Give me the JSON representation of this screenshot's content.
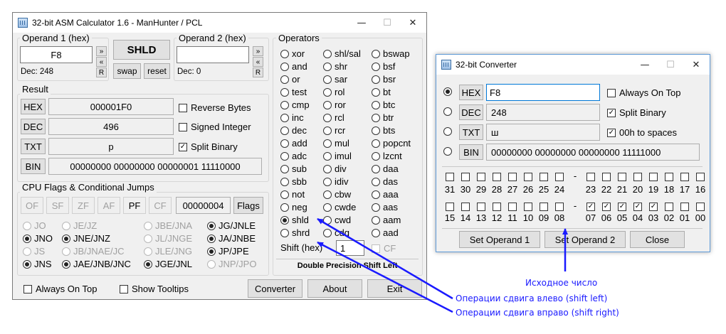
{
  "main": {
    "title": "32-bit ASM Calculator 1.6 - ManHunter / PCL",
    "operand1": {
      "label": "Operand 1 (hex)",
      "value": "F8",
      "dec_label": "Dec: 248"
    },
    "operand2": {
      "label": "Operand 2 (hex)",
      "value": "",
      "dec_label": "Dec: 0"
    },
    "mini": {
      "up": "»",
      "down": "«",
      "reset": "R"
    },
    "op_button": "SHLD",
    "swap": "swap",
    "reset": "reset",
    "result": {
      "label": "Result",
      "hex_btn": "HEX",
      "hex": "000001F0",
      "dec_btn": "DEC",
      "dec": "496",
      "txt_btn": "TXT",
      "txt": "\u0001p",
      "bin_btn": "BIN",
      "bin": "00000000 00000000 00000001 11110000",
      "reverse": "Reverse Bytes",
      "signed": "Signed Integer",
      "split": "Split Binary"
    },
    "flags": {
      "label": "CPU Flags & Conditional Jumps",
      "of": "OF",
      "sf": "SF",
      "zf": "ZF",
      "af": "AF",
      "pf": "PF",
      "cf": "CF",
      "value": "00000004",
      "flags_btn": "Flags"
    },
    "jumps": [
      [
        "JO",
        "JE/JZ",
        "JBE/JNA",
        "JG/JNLE"
      ],
      [
        "JNO",
        "JNE/JNZ",
        "JL/JNGE",
        "JA/JNBE"
      ],
      [
        "JS",
        "JB/JNAE/JC",
        "JLE/JNG",
        "JP/JPE"
      ],
      [
        "JNS",
        "JAE/JNB/JNC",
        "JGE/JNL",
        "JNP/JPO"
      ]
    ],
    "operators_label": "Operators",
    "operators": [
      [
        "xor",
        "shl/sal",
        "bswap"
      ],
      [
        "and",
        "shr",
        "bsf"
      ],
      [
        "or",
        "sar",
        "bsr"
      ],
      [
        "test",
        "rol",
        "bt"
      ],
      [
        "cmp",
        "ror",
        "btc"
      ],
      [
        "inc",
        "rcl",
        "btr"
      ],
      [
        "dec",
        "rcr",
        "bts"
      ],
      [
        "add",
        "mul",
        "popcnt"
      ],
      [
        "adc",
        "imul",
        "lzcnt"
      ],
      [
        "sub",
        "div",
        "daa"
      ],
      [
        "sbb",
        "idiv",
        "das"
      ],
      [
        "not",
        "cbw",
        "aaa"
      ],
      [
        "neg",
        "cwde",
        "aas"
      ],
      [
        "shld",
        "cwd",
        "aam"
      ],
      [
        "shrd",
        "cdq",
        "aad"
      ]
    ],
    "shift_label": "Shift (hex)",
    "shift_value": "1",
    "cf_label": "CF",
    "description": "Double Precision Shift Left",
    "always_on_top": "Always On Top",
    "show_tooltips": "Show Tooltips",
    "converter_btn": "Converter",
    "about_btn": "About",
    "exit_btn": "Exit",
    "win_min": "—",
    "win_max": "☐",
    "win_close": "✕"
  },
  "converter": {
    "title": "32-bit Converter",
    "hex_btn": "HEX",
    "hex": "F8",
    "dec_btn": "DEC",
    "dec": "248",
    "txt_btn": "TXT",
    "txt": "ш",
    "bin_btn": "BIN",
    "bin": "00000000 00000000 00000000 11111000",
    "always_on_top": "Always On Top",
    "split": "Split Binary",
    "spaces": "00h to spaces",
    "bits_top": [
      "31",
      "30",
      "29",
      "28",
      "27",
      "26",
      "25",
      "24",
      "23",
      "22",
      "21",
      "20",
      "19",
      "18",
      "17",
      "16"
    ],
    "bits_bottom": [
      "15",
      "14",
      "13",
      "12",
      "11",
      "10",
      "09",
      "08",
      "07",
      "06",
      "05",
      "04",
      "03",
      "02",
      "01",
      "00"
    ],
    "dash": "-",
    "set1": "Set Operand 1",
    "set2": "Set Operand 2",
    "close": "Close",
    "win_min": "—",
    "win_max": "☐",
    "win_close": "✕"
  },
  "annotations": {
    "source": "Исходное число",
    "shift_left": "Операции сдвига влево (shift left)",
    "shift_right": "Операции сдвига вправо (shift right)"
  }
}
